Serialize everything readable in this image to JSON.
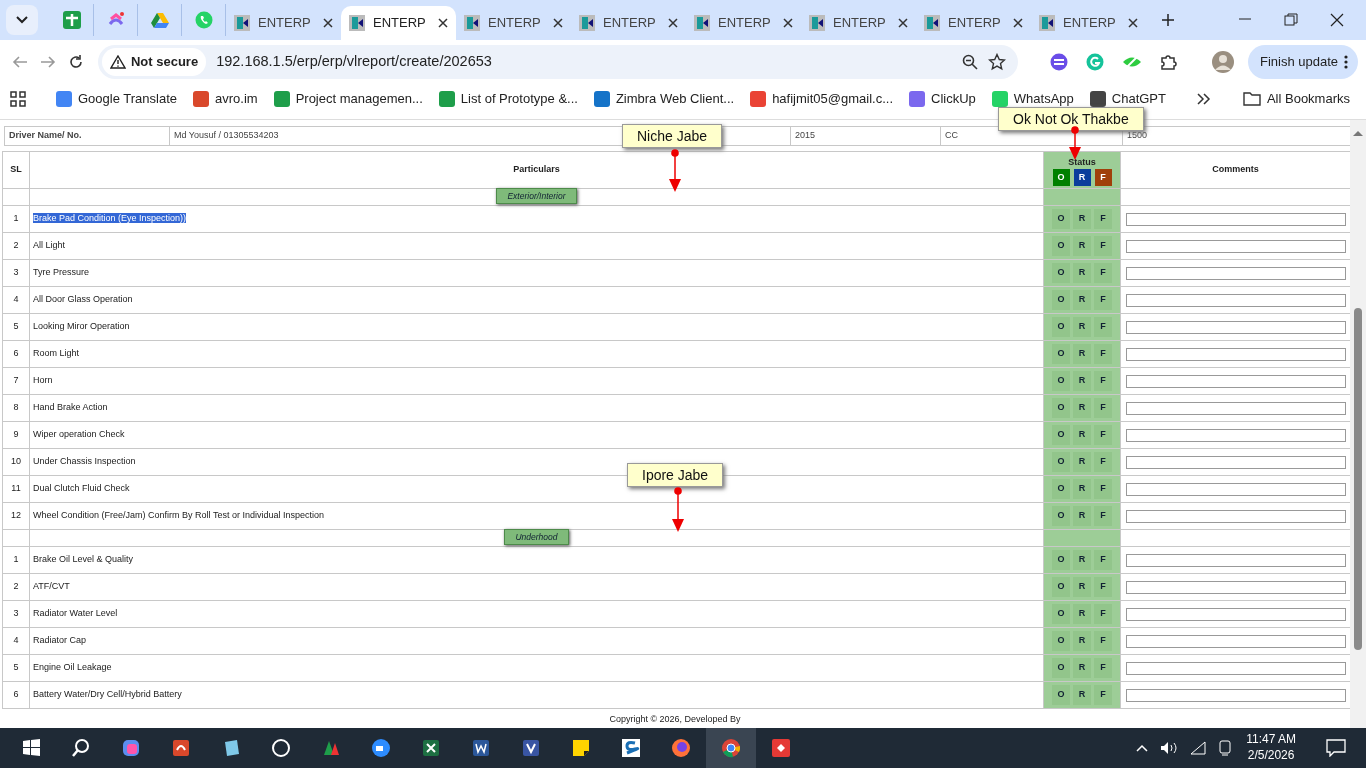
{
  "browser": {
    "tabs": [
      {
        "title": "ENTERP",
        "selected": false
      },
      {
        "title": "ENTERP",
        "selected": true
      },
      {
        "title": "ENTERP",
        "selected": false
      },
      {
        "title": "ENTERP",
        "selected": false
      },
      {
        "title": "ENTERP",
        "selected": false
      },
      {
        "title": "ENTERP",
        "selected": false
      },
      {
        "title": "ENTERP",
        "selected": false
      },
      {
        "title": "ENTERP",
        "selected": false
      }
    ],
    "security_label": "Not secure",
    "url": "192.168.1.5/erp/erp/vlreport/create/202653",
    "update_button": "Finish update",
    "bookmarks": [
      {
        "title": "Google Translate",
        "color": "#4285f4"
      },
      {
        "title": "avro.im",
        "color": "#d9482b"
      },
      {
        "title": "Project managemen...",
        "color": "#1e9e4a"
      },
      {
        "title": "List of Prototype &...",
        "color": "#1e9e4a"
      },
      {
        "title": "Zimbra Web Client...",
        "color": "#1573c8"
      },
      {
        "title": "hafijmit05@gmail.c...",
        "color": "#ea4335"
      },
      {
        "title": "ClickUp",
        "color": "#7b68ee"
      },
      {
        "title": "WhatsApp",
        "color": "#25d366"
      },
      {
        "title": "ChatGPT",
        "color": "#444444"
      }
    ],
    "all_bookmarks": "All Bookmarks"
  },
  "vehicle_info": {
    "label": "Driver Name/ No.",
    "value": "Md Yousuf / 01305534203",
    "cells": [
      "2015",
      "CC",
      "1500"
    ]
  },
  "table": {
    "columns": {
      "sl": "SL",
      "particulars": "Particulars",
      "status": "Status",
      "comments": "Comments"
    },
    "status_legend": [
      {
        "label": "O",
        "color": "#008000"
      },
      {
        "label": "R",
        "color": "#0a3d9c"
      },
      {
        "label": "F",
        "color": "#a0400a"
      }
    ],
    "sections": [
      {
        "title": "Exterior/Interior",
        "items": [
          {
            "sl": "1",
            "text": "Brake Pad Condition (Eye Inspection))",
            "selected": true,
            "options": [
              "O",
              "R",
              "F"
            ]
          },
          {
            "sl": "2",
            "text": "All Light",
            "selected": false,
            "options": [
              "O",
              "R",
              "F"
            ]
          },
          {
            "sl": "3",
            "text": "Tyre Pressure",
            "selected": false,
            "options": [
              "O",
              "R",
              "F"
            ]
          },
          {
            "sl": "4",
            "text": "All Door Glass Operation",
            "selected": false,
            "options": [
              "O",
              "R",
              "F"
            ]
          },
          {
            "sl": "5",
            "text": "Looking Miror Operation",
            "selected": false,
            "options": [
              "O",
              "R",
              "F"
            ]
          },
          {
            "sl": "6",
            "text": "Room Light",
            "selected": false,
            "options": [
              "O",
              "R",
              "F"
            ]
          },
          {
            "sl": "7",
            "text": "Horn",
            "selected": false,
            "options": [
              "O",
              "R",
              "F"
            ]
          },
          {
            "sl": "8",
            "text": "Hand Brake Action",
            "selected": false,
            "options": [
              "O",
              "R",
              "F"
            ]
          },
          {
            "sl": "9",
            "text": "Wiper operation Check",
            "selected": false,
            "options": [
              "O",
              "R",
              "F"
            ]
          },
          {
            "sl": "10",
            "text": "Under Chassis Inspection",
            "selected": false,
            "options": [
              "O",
              "R",
              "F"
            ]
          },
          {
            "sl": "11",
            "text": "Dual Clutch Fluid Check",
            "selected": false,
            "options": [
              "O",
              "R",
              "F"
            ]
          },
          {
            "sl": "12",
            "text": "Wheel Condition (Free/Jam) Confirm By Roll Test or Individual Inspection",
            "selected": false,
            "options": [
              "O",
              "R",
              "F"
            ]
          }
        ]
      },
      {
        "title": "Underhood",
        "items": [
          {
            "sl": "1",
            "text": "Brake Oil Level & Quality",
            "selected": false,
            "options": [
              "O",
              "R",
              "F"
            ]
          },
          {
            "sl": "2",
            "text": "ATF/CVT",
            "selected": false,
            "options": [
              "O",
              "R",
              "F"
            ]
          },
          {
            "sl": "3",
            "text": "Radiator Water Level",
            "selected": false,
            "options": [
              "O",
              "R",
              "F"
            ]
          },
          {
            "sl": "4",
            "text": "Radiator Cap",
            "selected": false,
            "options": [
              "O",
              "R",
              "F"
            ]
          },
          {
            "sl": "5",
            "text": "Engine Oil Leakage",
            "selected": false,
            "options": [
              "O",
              "R",
              "F"
            ]
          },
          {
            "sl": "6",
            "text": "Battery Water/Dry Cell/Hybrid Battery",
            "selected": false,
            "options": [
              "O",
              "R",
              "F"
            ]
          }
        ]
      }
    ]
  },
  "callouts": [
    {
      "text": "Niche Jabe"
    },
    {
      "text": "Ok Not Ok Thakbe"
    },
    {
      "text": "Ipore Jabe"
    }
  ],
  "footer": "Copyright © 2026, Developed By",
  "taskbar": {
    "time": "11:47 AM",
    "date": "2/5/2026"
  }
}
